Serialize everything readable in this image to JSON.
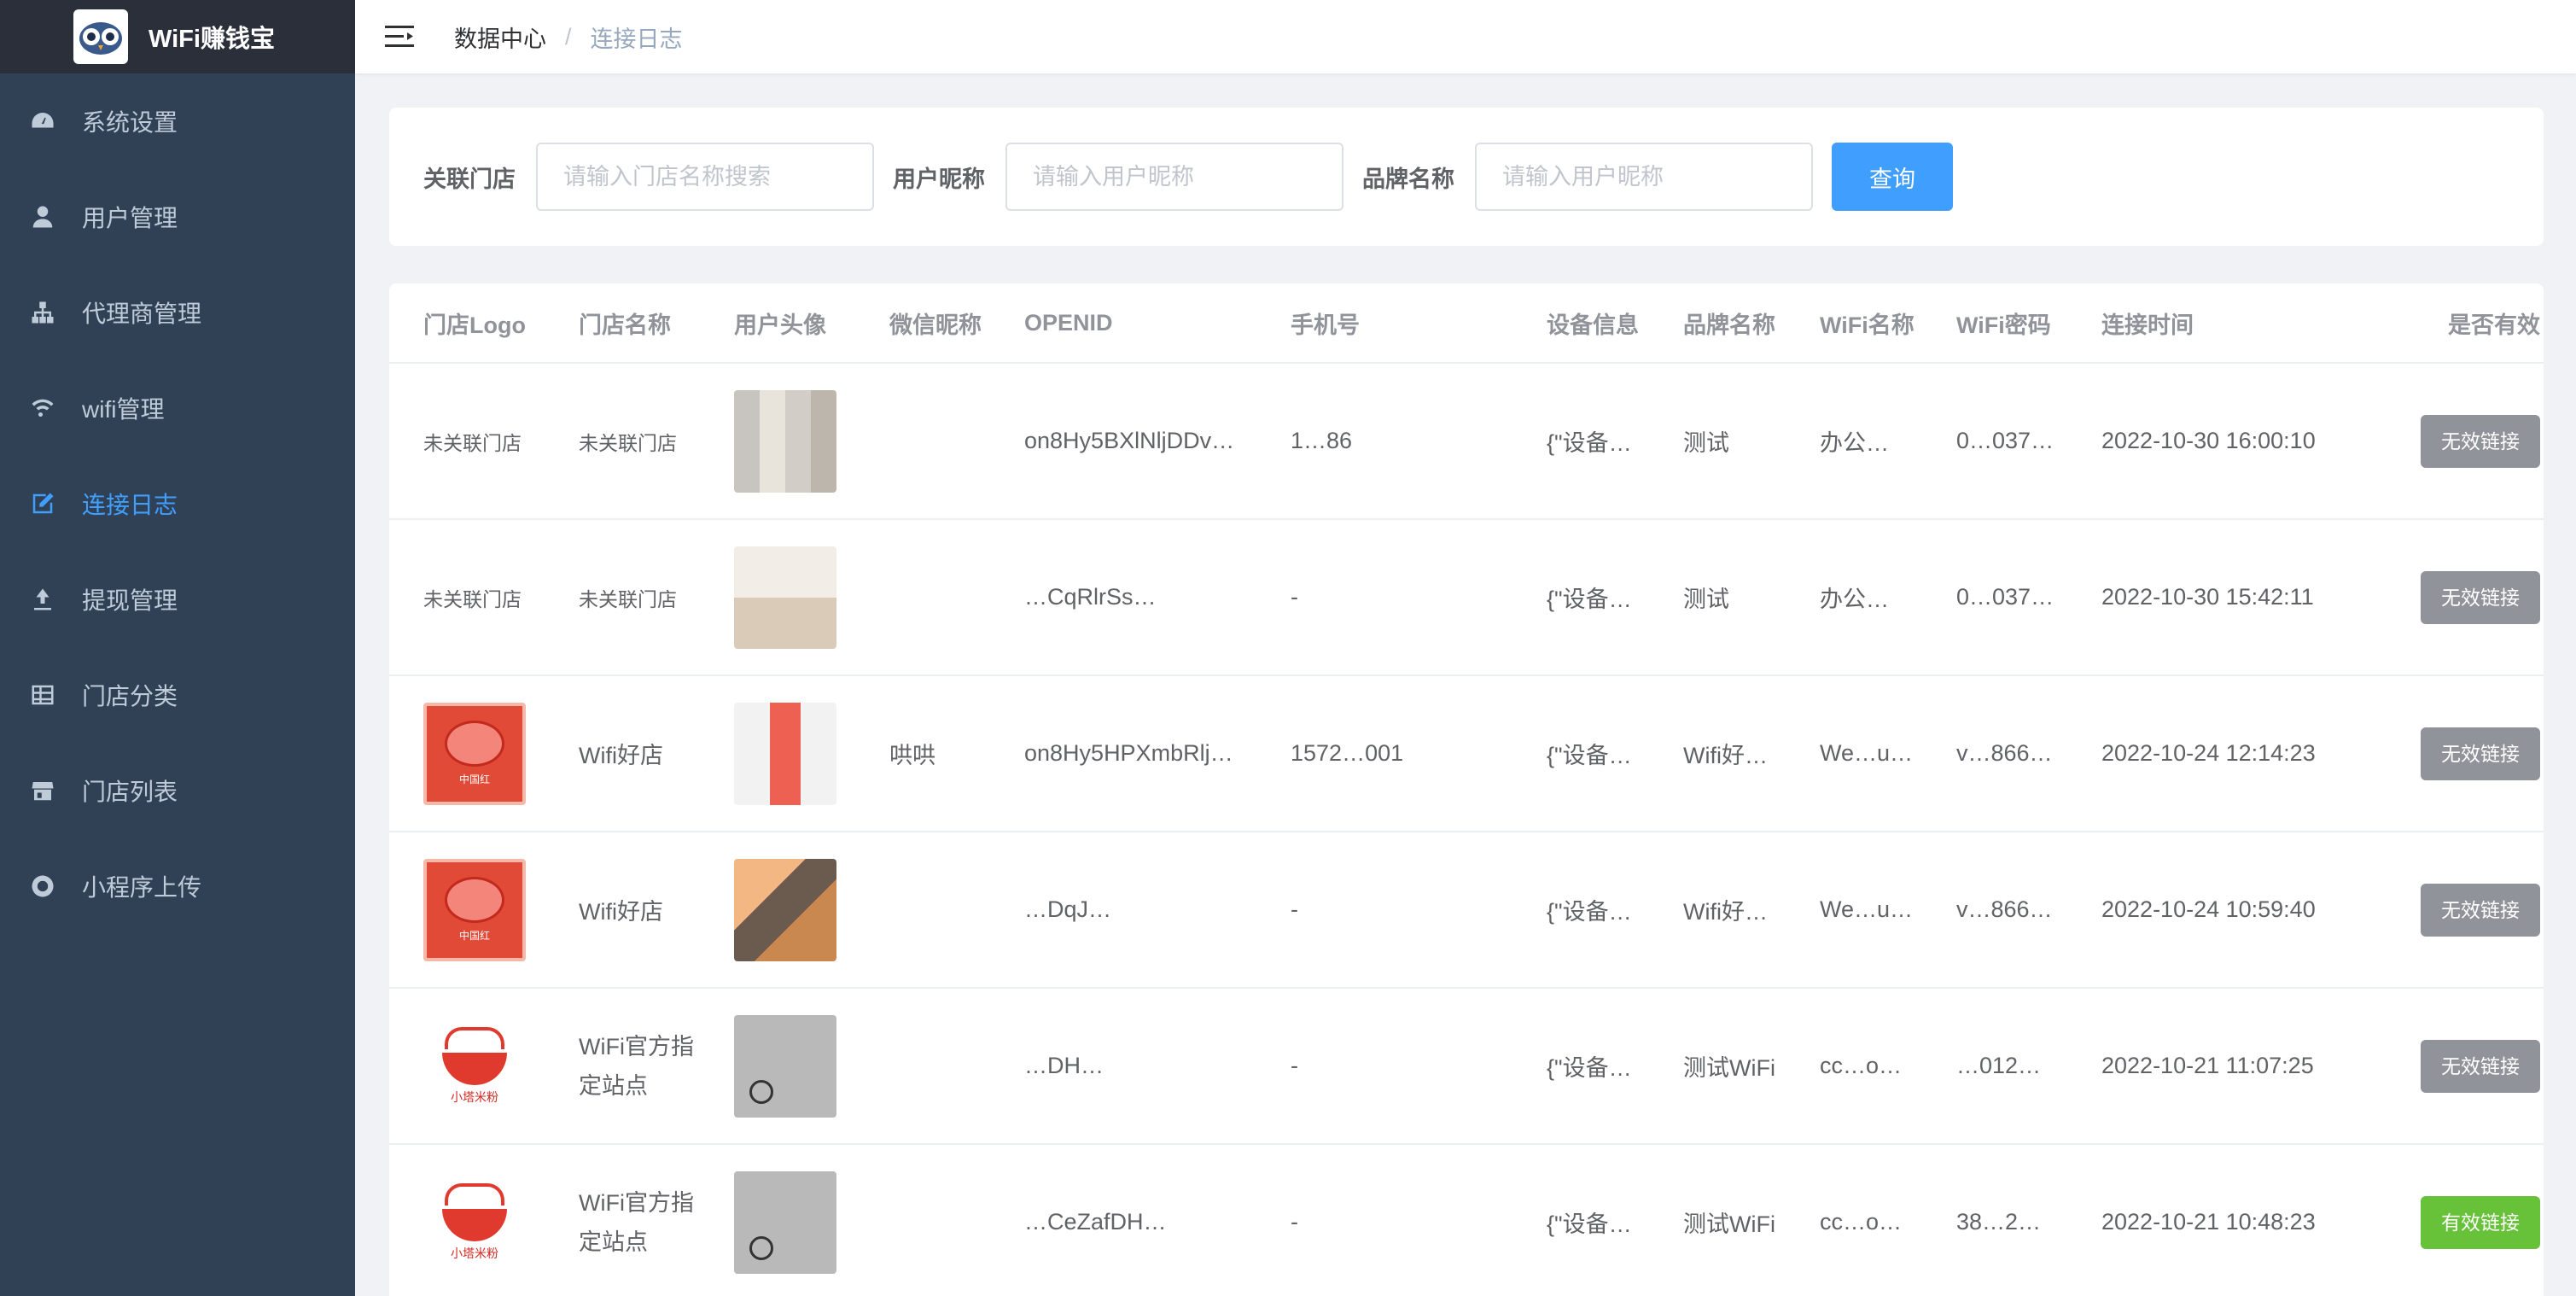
{
  "app": {
    "title": "WiFi赚钱宝"
  },
  "sidebar": {
    "items": [
      {
        "label": "系统设置",
        "icon": "dashboard-icon"
      },
      {
        "label": "用户管理",
        "icon": "user-icon"
      },
      {
        "label": "代理商管理",
        "icon": "org-tree-icon"
      },
      {
        "label": "wifi管理",
        "icon": "wifi-icon"
      },
      {
        "label": "连接日志",
        "icon": "edit-log-icon",
        "active": true
      },
      {
        "label": "提现管理",
        "icon": "withdraw-icon"
      },
      {
        "label": "门店分类",
        "icon": "grid-icon"
      },
      {
        "label": "门店列表",
        "icon": "store-icon"
      },
      {
        "label": "小程序上传",
        "icon": "upload-icon"
      }
    ]
  },
  "breadcrumb": {
    "root": "数据中心",
    "sep": "/",
    "current": "连接日志"
  },
  "search": {
    "store_label": "关联门店",
    "store_placeholder": "请输入门店名称搜索",
    "nick_label": "用户昵称",
    "nick_placeholder": "请输入用户昵称",
    "brand_label": "品牌名称",
    "brand_placeholder": "请输入用户昵称",
    "query_button": "查询"
  },
  "table": {
    "headers": [
      "门店Logo",
      "门店名称",
      "用户头像",
      "微信昵称",
      "OPENID",
      "手机号",
      "设备信息",
      "品牌名称",
      "WiFi名称",
      "WiFi密码",
      "连接时间",
      "是否有效"
    ],
    "rows": [
      {
        "logo_text": "未关联门店",
        "store": "未关联门店",
        "nick": "",
        "openid": "on8Hy5BXlNljDDv…",
        "phone": "1…86",
        "device": "{\"设备…",
        "brand": "测试",
        "wifi": "办公…",
        "pwd": "0…037…",
        "time": "2022-10-30 16:00:10",
        "valid": "无效链接"
      },
      {
        "logo_text": "未关联门店",
        "store": "未关联门店",
        "nick": "",
        "openid": "…CqRlrSs…",
        "phone": "-",
        "device": "{\"设备…",
        "brand": "测试",
        "wifi": "办公…",
        "pwd": "0…037…",
        "time": "2022-10-30 15:42:11",
        "valid": "无效链接"
      },
      {
        "logo_text": "",
        "store": "Wifi好店",
        "nick": "哄哄",
        "openid": "on8Hy5HPXmbRlj…",
        "phone": "1572…001",
        "device": "{\"设备…",
        "brand": "Wifi好…",
        "wifi": "We…u…",
        "pwd": "v…866…",
        "time": "2022-10-24 12:14:23",
        "valid": "无效链接"
      },
      {
        "logo_text": "",
        "store": "Wifi好店",
        "nick": "",
        "openid": "…DqJ…",
        "phone": "-",
        "device": "{\"设备…",
        "brand": "Wifi好…",
        "wifi": "We…u…",
        "pwd": "v…866…",
        "time": "2022-10-24 10:59:40",
        "valid": "无效链接"
      },
      {
        "logo_text": "",
        "store": "WiFi官方指定站点",
        "nick": "",
        "openid": "…DH…",
        "phone": "-",
        "device": "{\"设备…",
        "brand": "测试WiFi",
        "wifi": "cc…o…",
        "pwd": "…012…",
        "time": "2022-10-21 11:07:25",
        "valid": "无效链接"
      },
      {
        "logo_text": "",
        "store": "WiFi官方指定站点",
        "nick": "",
        "openid": "…CeZafDH…",
        "phone": "-",
        "device": "{\"设备…",
        "brand": "测试WiFi",
        "wifi": "cc…o…",
        "pwd": "38…2…",
        "time": "2022-10-21 10:48:23",
        "valid": "有效链接"
      }
    ]
  },
  "colors": {
    "sidebar_bg": "#304156",
    "accent": "#409eff",
    "invalid": "#909399",
    "valid": "#67c23a"
  }
}
